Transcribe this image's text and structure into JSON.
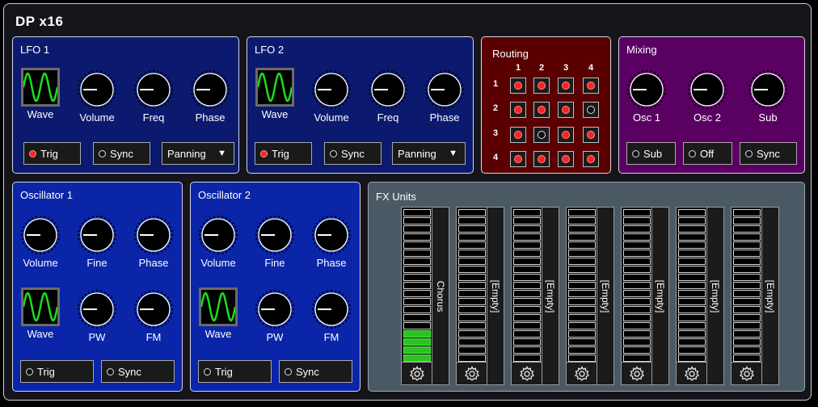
{
  "app": {
    "title": "DP x16"
  },
  "lfo1": {
    "title": "LFO 1",
    "knobs": [
      {
        "label": "Wave",
        "type": "wave"
      },
      {
        "label": "Volume",
        "type": "knob"
      },
      {
        "label": "Freq",
        "type": "knob"
      },
      {
        "label": "Phase",
        "type": "knob"
      }
    ],
    "buttons": [
      {
        "label": "Trig",
        "led": "on"
      },
      {
        "label": "Sync",
        "led": "off"
      },
      {
        "label": "Panning",
        "type": "dropdown",
        "arrow": "▼"
      }
    ]
  },
  "lfo2": {
    "title": "LFO 2",
    "knobs": [
      {
        "label": "Wave"
      },
      {
        "label": "Volume"
      },
      {
        "label": "Freq"
      },
      {
        "label": "Phase"
      }
    ],
    "buttons": [
      {
        "label": "Trig",
        "led": "on"
      },
      {
        "label": "Sync",
        "led": "off"
      },
      {
        "label": "Panning",
        "arrow": "▼"
      }
    ]
  },
  "routing": {
    "title": "Routing",
    "columns": [
      "1",
      "2",
      "3",
      "4"
    ],
    "rows": [
      "1",
      "2",
      "3",
      "4"
    ],
    "matrix": [
      [
        true,
        true,
        true,
        true
      ],
      [
        true,
        true,
        true,
        false
      ],
      [
        true,
        false,
        true,
        true
      ],
      [
        true,
        true,
        true,
        true
      ]
    ]
  },
  "mixing": {
    "title": "Mixing",
    "knobs": [
      {
        "label": "Osc 1"
      },
      {
        "label": "Osc 2"
      },
      {
        "label": "Sub"
      }
    ],
    "buttons": [
      {
        "label": "Sub",
        "led": "off"
      },
      {
        "label": "Off",
        "led": "off"
      },
      {
        "label": "Sync",
        "led": "off"
      }
    ]
  },
  "osc1": {
    "title": "Oscillator 1",
    "knobs": [
      {
        "label": "Volume"
      },
      {
        "label": "Fine"
      },
      {
        "label": "Phase"
      },
      {
        "label": "Wave"
      },
      {
        "label": "PW"
      },
      {
        "label": "FM"
      }
    ],
    "buttons": [
      {
        "label": "Trig",
        "led": "off"
      },
      {
        "label": "Sync",
        "led": "off"
      }
    ]
  },
  "osc2": {
    "title": "Oscillator 2",
    "knobs": [
      {
        "label": "Volume"
      },
      {
        "label": "Fine"
      },
      {
        "label": "Phase"
      },
      {
        "label": "Wave"
      },
      {
        "label": "PW"
      },
      {
        "label": "FM"
      }
    ],
    "buttons": [
      {
        "label": "Trig",
        "led": "off"
      },
      {
        "label": "Sync",
        "led": "off"
      }
    ]
  },
  "fx": {
    "title": "FX Units",
    "slots": [
      {
        "name": "Chorus",
        "level_segments_lit": 4
      },
      {
        "name": "[Empty]",
        "level_segments_lit": 0
      },
      {
        "name": "[Empty]",
        "level_segments_lit": 0
      },
      {
        "name": "[Empty]",
        "level_segments_lit": 0
      },
      {
        "name": "[Empty]",
        "level_segments_lit": 0
      },
      {
        "name": "[Empty]",
        "level_segments_lit": 0
      },
      {
        "name": "[Empty]",
        "level_segments_lit": 0
      }
    ],
    "meter_segments_total": 19,
    "gear_icon": "gear-icon"
  },
  "colors": {
    "lfo_panel": "#0b1a6e",
    "osc_panel": "#0a25a8",
    "routing_panel": "#5a0000",
    "mixing_panel": "#5a0063",
    "fx_panel": "#4a5963",
    "led_on": "#ff2020",
    "meter_lit": "#29c41f",
    "wave": "#19e01a"
  }
}
